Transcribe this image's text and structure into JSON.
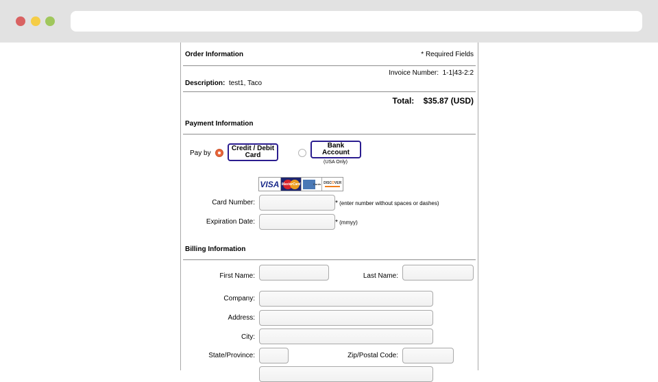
{
  "browser": {
    "url": ""
  },
  "order": {
    "section_title": "Order Information",
    "required_note": "* Required Fields",
    "invoice_label": "Invoice Number:",
    "invoice_value": "1-1|43-2:2",
    "description_label": "Description:",
    "description_value": "test1, Taco",
    "total_label": "Total:",
    "total_value": "$35.87 (USD)"
  },
  "payment": {
    "section_title": "Payment Information",
    "pay_by_label": "Pay by",
    "options": [
      {
        "label": "Credit / Debit Card",
        "selected": true
      },
      {
        "label": "Bank Account",
        "note": "(USA Only)",
        "selected": false
      }
    ],
    "accepted_cards": [
      "VISA",
      "MasterCard",
      "American Express",
      "DISCOVER"
    ],
    "card_number_label": "Card Number:",
    "card_number_value": "",
    "card_number_hint": "(enter number without spaces or dashes)",
    "expiration_label": "Expiration Date:",
    "expiration_value": "",
    "expiration_hint": "(mmyy)",
    "required_marker": "*"
  },
  "billing": {
    "section_title": "Billing Information",
    "first_name_label": "First Name:",
    "last_name_label": "Last Name:",
    "company_label": "Company:",
    "address_label": "Address:",
    "city_label": "City:",
    "state_label": "State/Province:",
    "zip_label": "Zip/Postal Code:"
  },
  "colors": {
    "radio_selected": "#e8663c",
    "pay_button_border": "#2a1c8f"
  }
}
